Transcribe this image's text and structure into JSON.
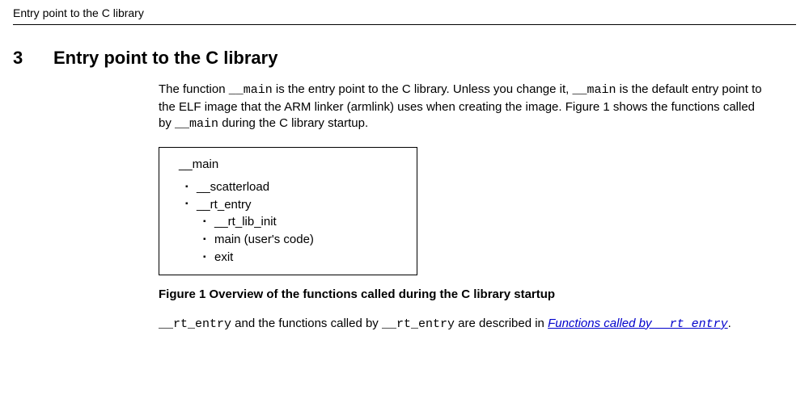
{
  "running_header": "Entry point to the C library",
  "section": {
    "number": "3",
    "title": "Entry point to the C library"
  },
  "paragraph1": {
    "t1": "The function ",
    "c1": "__main",
    "t2": " is the entry point to the C library. Unless you change it, ",
    "c2": "__main",
    "t3": " is the default entry point to the ELF image that the ARM linker (armlink) uses when creating the image. Figure 1 shows the functions called by ",
    "c3": "__main",
    "t4": " during the C library startup."
  },
  "figure": {
    "root": "__main",
    "level1": {
      "i0": "__scatterload",
      "i1": "__rt_entry"
    },
    "level2": {
      "i0": "__rt_lib_init",
      "i1": "main (user's code)",
      "i2": "exit"
    }
  },
  "figure_caption": "Figure 1 Overview of the functions called during the C library startup",
  "paragraph2": {
    "c1": "__rt_entry",
    "t1": " and the functions called by ",
    "c2": "__rt_entry",
    "t2": " are described in ",
    "link_t1": "Functions called by ",
    "link_c1": "__rt_entry",
    "t3": "."
  }
}
